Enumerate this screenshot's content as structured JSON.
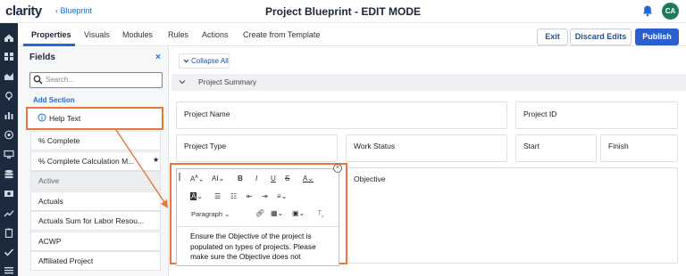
{
  "app": {
    "logo": "clarity",
    "back_link": "Blueprint",
    "title": "Project Blueprint - EDIT MODE",
    "avatar_initials": "CA"
  },
  "tabs": [
    {
      "label": "Properties",
      "active": true
    },
    {
      "label": "Visuals"
    },
    {
      "label": "Modules"
    },
    {
      "label": "Rules"
    },
    {
      "label": "Actions"
    },
    {
      "label": "Create from Template"
    }
  ],
  "buttons": {
    "exit": "Exit",
    "discard": "Discard Edits",
    "publish": "Publish"
  },
  "fields_panel": {
    "title": "Fields",
    "close": "×",
    "search_placeholder": "Search...",
    "add_section": "Add Section",
    "help_text": "Help Text",
    "items": [
      {
        "label": "% Complete",
        "dim": false
      },
      {
        "label": "% Complete Calculation M...",
        "dim": false
      },
      {
        "label": "Active",
        "dim": true
      },
      {
        "label": "Actuals",
        "dim": false
      },
      {
        "label": "Actuals Sum for Labor Resou...",
        "dim": false
      },
      {
        "label": "ACWP",
        "dim": false
      },
      {
        "label": "Affiliated Project",
        "dim": false
      }
    ],
    "required_marker": "★"
  },
  "main": {
    "collapse_all": "Collapse All",
    "section_title": "Project Summary",
    "fields": {
      "project_name": "Project Name",
      "project_id": "Project ID",
      "project_type": "Project Type",
      "work_status": "Work Status",
      "start": "Start",
      "finish": "Finish",
      "objective": "Objective"
    }
  },
  "editor": {
    "paragraph_label": "Paragraph",
    "content": "Ensure the Objective of the project is populated on types of projects. Please make sure the Objective does not"
  },
  "colors": {
    "accent": "#1e6bd6",
    "highlight": "#e8763a",
    "nav": "#1c2a3e",
    "publish": "#2b5fd0"
  }
}
